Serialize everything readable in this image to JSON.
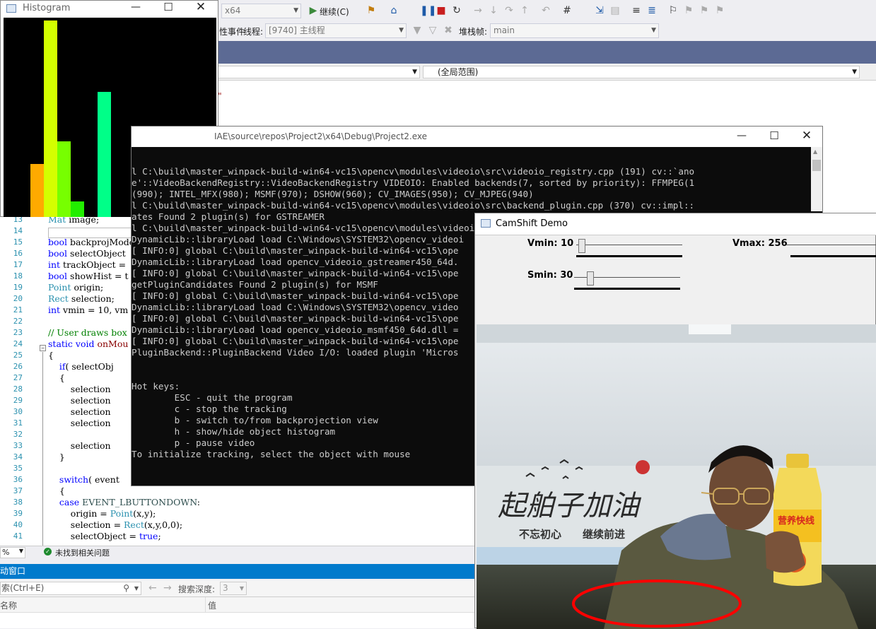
{
  "toolbar": {
    "platform_value": "x64",
    "continue_label": "继续(C)",
    "process_prefix": "性事件",
    "thread_label": "线程:",
    "thread_value": "[9740] 主线程",
    "stackframe_label": "堆栈帧:",
    "stackframe_value": "main"
  },
  "navbar": {
    "scope_value": "(全局范围)"
  },
  "editor": {
    "string_line1": "\"",
    "string_line2": "p\"",
    "lines": [
      {
        "n": "13",
        "html": "<span class='ty'>Mat</span> image;"
      },
      {
        "n": "14",
        "html": ""
      },
      {
        "n": "15",
        "html": "<span class='kw'>bool</span> backprojMode"
      },
      {
        "n": "16",
        "html": "<span class='kw'>bool</span> selectObject"
      },
      {
        "n": "17",
        "html": "<span class='kw'>int</span> trackObject ="
      },
      {
        "n": "18",
        "html": "<span class='kw'>bool</span> showHist = t"
      },
      {
        "n": "19",
        "html": "<span class='ty'>Point</span> origin;"
      },
      {
        "n": "20",
        "html": "<span class='ty'>Rect</span> selection;"
      },
      {
        "n": "21",
        "html": "<span class='kw'>int</span> vmin = 10, vm"
      },
      {
        "n": "22",
        "html": ""
      },
      {
        "n": "23",
        "html": "<span class='cm'>// User draws box</span>"
      },
      {
        "n": "24",
        "html": "<span class='kw'>static void</span> <span class='fn'>onMou</span>"
      },
      {
        "n": "25",
        "html": "{"
      },
      {
        "n": "26",
        "html": "    <span class='kw'>if</span>( selectObj"
      },
      {
        "n": "27",
        "html": "    {"
      },
      {
        "n": "28",
        "html": "        selection"
      },
      {
        "n": "29",
        "html": "        selection"
      },
      {
        "n": "30",
        "html": "        selection"
      },
      {
        "n": "31",
        "html": "        selection"
      },
      {
        "n": "32",
        "html": ""
      },
      {
        "n": "33",
        "html": "        selection"
      },
      {
        "n": "34",
        "html": "    }"
      },
      {
        "n": "35",
        "html": ""
      },
      {
        "n": "36",
        "html": "    <span class='kw'>switch</span>( event"
      },
      {
        "n": "37",
        "html": "    {"
      },
      {
        "n": "38",
        "html": "    <span class='kw'>case</span> <span class='en'>EVENT_LBUTTONDOWN</span>:"
      },
      {
        "n": "39",
        "html": "        origin = <span class='ty'>Point</span>(x,y);"
      },
      {
        "n": "40",
        "html": "        selection = <span class='ty'>Rect</span>(x,y,0,0);"
      },
      {
        "n": "41",
        "html": "        selectObject = <span class='kw'>true</span>;"
      }
    ]
  },
  "status": {
    "zoom": "%",
    "message": "未找到相关问题"
  },
  "autos": {
    "title": "动窗口",
    "search_placeholder": "索(Ctrl+E)",
    "depth_label": "搜索深度:",
    "depth_value": "3",
    "col_name": "名称",
    "col_value": "值"
  },
  "histogram": {
    "title": "Histogram",
    "bars": [
      {
        "height_frac": 0.27,
        "color": "#ffaa00"
      },
      {
        "height_frac": 1.0,
        "color": "#d4ff00"
      },
      {
        "height_frac": 0.385,
        "color": "#77ff00"
      },
      {
        "height_frac": 0.08,
        "color": "#22ee00"
      },
      {
        "height_frac": 0.0,
        "color": "#00ff44"
      },
      {
        "height_frac": 0.635,
        "color": "#00ff88"
      }
    ]
  },
  "console": {
    "title": "IAE\\source\\repos\\Project2\\x64\\Debug\\Project2.exe",
    "lines": [
      "l C:\\build\\master_winpack-build-win64-vc15\\opencv\\modules\\videoio\\src\\videoio_registry.cpp (191) cv::`ano",
      "e'::VideoBackendRegistry::VideoBackendRegistry VIDEOIO: Enabled backends(7, sorted by priority): FFMPEG(1",
      "(990); INTEL_MFX(980); MSMF(970); DSHOW(960); CV_IMAGES(950); CV_MJPEG(940)",
      "l C:\\build\\master_winpack-build-win64-vc15\\opencv\\modules\\videoio\\src\\backend_plugin.cpp (370) cv::impl::",
      "ates Found 2 plugin(s) for GSTREAMER",
      "l C:\\build\\master_winpack-build-win64-vc15\\opencv\\modules\\videoio\\src\\backend_plugin.cpp (175) cv::impl::",
      "DynamicLib::libraryLoad load C:\\Windows\\SYSTEM32\\opencv_videoi",
      "[ INFO:0] global C:\\build\\master_winpack-build-win64-vc15\\ope",
      "DynamicLib::libraryLoad load opencv_videoio_gstreamer450_64d.",
      "[ INFO:0] global C:\\build\\master_winpack-build-win64-vc15\\ope",
      "getPluginCandidates Found 2 plugin(s) for MSMF",
      "[ INFO:0] global C:\\build\\master_winpack-build-win64-vc15\\ope",
      "DynamicLib::libraryLoad load C:\\Windows\\SYSTEM32\\opencv_video",
      "[ INFO:0] global C:\\build\\master_winpack-build-win64-vc15\\ope",
      "DynamicLib::libraryLoad load opencv_videoio_msmf450_64d.dll =",
      "[ INFO:0] global C:\\build\\master_winpack-build-win64-vc15\\ope",
      "PluginBackend::PluginBackend Video I/O: loaded plugin 'Micros",
      "",
      "",
      "Hot keys:",
      "        ESC - quit the program",
      "        c - stop the tracking",
      "        b - switch to/from backprojection view",
      "        h - show/hide object histogram",
      "        p - pause video",
      "To initialize tracking, select the object with mouse"
    ]
  },
  "camshift": {
    "title": "CamShift Demo",
    "vmin_label": "Vmin: 10",
    "vmin_value": 10,
    "vmax_label": "Vmax: 256",
    "vmax_value": 256,
    "smin_label": "Smin: 30",
    "smin_value": 30,
    "banner_text_1": "不忘初心",
    "banner_text_2": "继续前进",
    "bottle_label": "营养快线",
    "ellipse_color": "#ff0000"
  }
}
